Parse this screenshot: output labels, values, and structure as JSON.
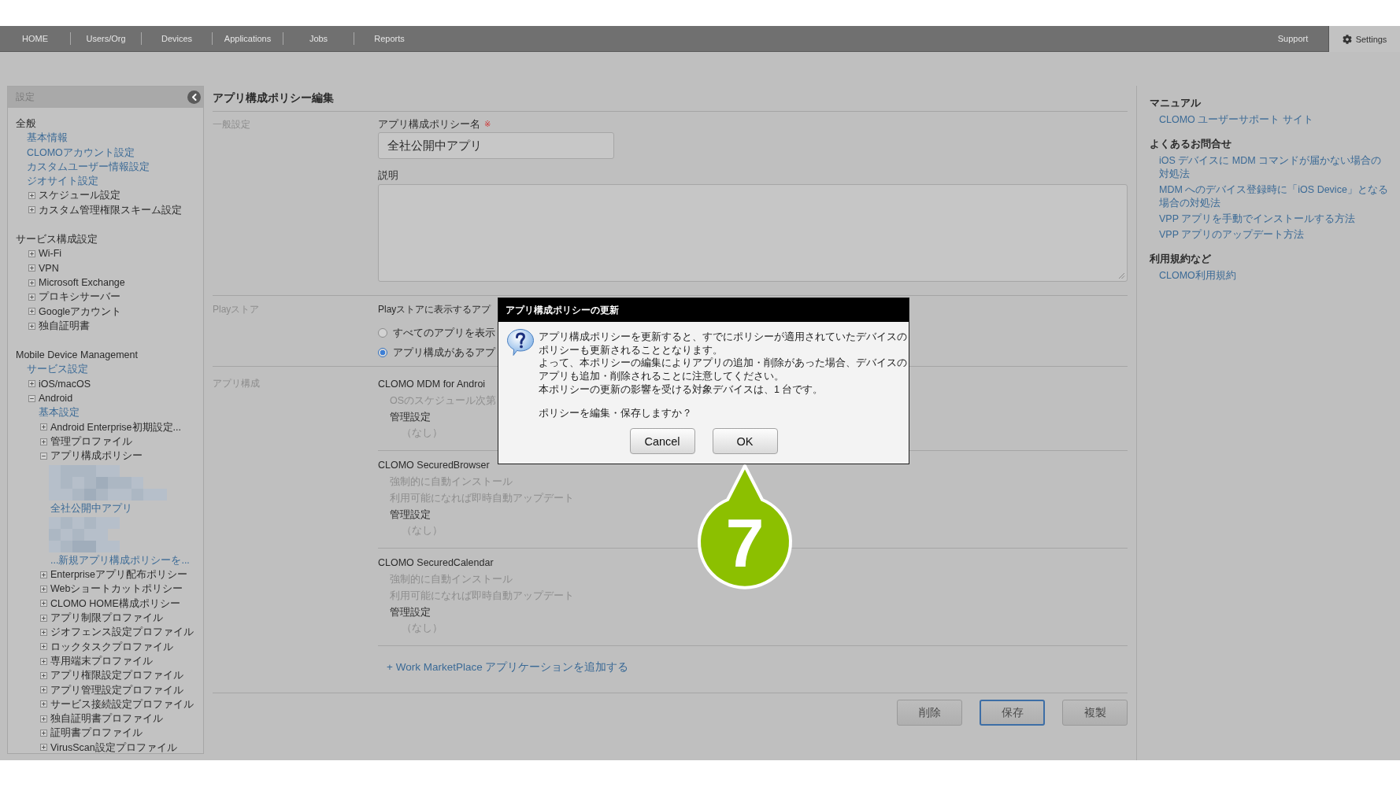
{
  "nav": {
    "items": [
      {
        "label": "HOME",
        "selected": false
      },
      {
        "label": "Users/Org",
        "selected": false
      },
      {
        "label": "Devices",
        "selected": false
      },
      {
        "label": "Applications",
        "selected": false
      },
      {
        "label": "Jobs",
        "selected": false
      },
      {
        "label": "Reports",
        "selected": false
      }
    ],
    "support": {
      "label": "Support"
    },
    "settings_tab": {
      "label": "Settings",
      "selected": true
    }
  },
  "sidebar": {
    "title": "設定",
    "sections": [
      {
        "title": "全般",
        "items": [
          {
            "kind": "link",
            "label": "基本情報"
          },
          {
            "kind": "link",
            "label": "CLOMOアカウント設定"
          },
          {
            "kind": "link",
            "label": "カスタムユーザー情報設定"
          },
          {
            "kind": "link",
            "label": "ジオサイト設定"
          },
          {
            "kind": "folder",
            "label": "スケジュール設定",
            "expanded": false
          },
          {
            "kind": "folder",
            "label": "カスタム管理権限スキーム設定",
            "expanded": false
          }
        ]
      },
      {
        "title": "サービス構成設定",
        "items": [
          {
            "kind": "folder",
            "label": "Wi-Fi",
            "expanded": false
          },
          {
            "kind": "folder",
            "label": "VPN",
            "expanded": false
          },
          {
            "kind": "folder",
            "label": "Microsoft Exchange",
            "expanded": false
          },
          {
            "kind": "folder",
            "label": "プロキシサーバー",
            "expanded": false
          },
          {
            "kind": "folder",
            "label": "Googleアカウント",
            "expanded": false
          },
          {
            "kind": "folder",
            "label": "独自証明書",
            "expanded": false
          }
        ]
      },
      {
        "title": "Mobile Device Management",
        "items": [
          {
            "kind": "link",
            "label": "サービス設定"
          },
          {
            "kind": "folder",
            "label": "iOS/macOS",
            "expanded": false
          },
          {
            "kind": "folder",
            "label": "Android",
            "expanded": true,
            "children": [
              {
                "kind": "link",
                "label": "基本設定"
              },
              {
                "kind": "folder",
                "label": "Android Enterprise初期設定...",
                "expanded": false
              },
              {
                "kind": "folder",
                "label": "管理プロファイル",
                "expanded": false
              },
              {
                "kind": "folder",
                "label": "アプリ構成ポリシー",
                "expanded": true,
                "children": [
                  {
                    "kind": "redacted"
                  },
                  {
                    "kind": "link",
                    "label": "全社公開中アプリ"
                  },
                  {
                    "kind": "redacted"
                  },
                  {
                    "kind": "link",
                    "label": "...新規アプリ構成ポリシーを..."
                  }
                ]
              },
              {
                "kind": "folder",
                "label": "Enterpriseアプリ配布ポリシー",
                "expanded": false
              },
              {
                "kind": "folder",
                "label": "Webショートカットポリシー",
                "expanded": false
              },
              {
                "kind": "folder",
                "label": "CLOMO HOME構成ポリシー",
                "expanded": false
              },
              {
                "kind": "folder",
                "label": "アプリ制限プロファイル",
                "expanded": false
              },
              {
                "kind": "folder",
                "label": "ジオフェンス設定プロファイル",
                "expanded": false
              },
              {
                "kind": "folder",
                "label": "ロックタスクプロファイル",
                "expanded": false
              },
              {
                "kind": "folder",
                "label": "専用端末プロファイル",
                "expanded": false
              },
              {
                "kind": "folder",
                "label": "アプリ権限設定プロファイル",
                "expanded": false
              },
              {
                "kind": "folder",
                "label": "アプリ管理設定プロファイル",
                "expanded": false
              },
              {
                "kind": "folder",
                "label": "サービス接続設定プロファイル",
                "expanded": false
              },
              {
                "kind": "folder",
                "label": "独自証明書プロファイル",
                "expanded": false
              },
              {
                "kind": "folder",
                "label": "証明書プロファイル",
                "expanded": false
              },
              {
                "kind": "folder",
                "label": "VirusScan設定プロファイル",
                "expanded": false
              }
            ]
          }
        ]
      }
    ]
  },
  "main": {
    "title": "アプリ構成ポリシー編集",
    "general": {
      "label": "一般設定",
      "name_label": "アプリ構成ポリシー名",
      "required_mark": "※",
      "name_value": "全社公開中アプリ",
      "description_label": "説明"
    },
    "play_store": {
      "label": "Playストア",
      "prompt": "Playストアに表示するアプ",
      "options": [
        {
          "label": "すべてのアプリを表示",
          "selected": false
        },
        {
          "label": "アプリ構成があるアプ",
          "selected": true
        }
      ]
    },
    "app_config": {
      "label": "アプリ構成",
      "apps": [
        {
          "name": "CLOMO MDM for Androi",
          "notes": [
            "OSのスケジュール次第"
          ],
          "settings_label": "管理設定",
          "settings_value": "（なし）"
        },
        {
          "name": "CLOMO SecuredBrowser",
          "notes": [
            "強制的に自動インストール",
            "利用可能になれば即時自動アップデート"
          ],
          "settings_label": "管理設定",
          "settings_value": "（なし）"
        },
        {
          "name": "CLOMO SecuredCalendar",
          "notes": [
            "強制的に自動インストール",
            "利用可能になれば即時自動アップデート"
          ],
          "settings_label": "管理設定",
          "settings_value": "（なし）"
        }
      ],
      "add_link": "+ Work MarketPlace アプリケーションを追加する"
    },
    "actions": [
      {
        "label": "削除",
        "kind": "default"
      },
      {
        "label": "保存",
        "kind": "primary"
      },
      {
        "label": "複製",
        "kind": "default"
      }
    ]
  },
  "help": {
    "sections": [
      {
        "title": "マニュアル",
        "links": [
          "CLOMO ユーザーサポート サイト"
        ]
      },
      {
        "title": "よくあるお問合せ",
        "links": [
          "iOS デバイスに MDM コマンドが届かない場合の対処法",
          "MDM へのデバイス登録時に「iOS Device」となる場合の対処法",
          "VPP アプリを手動でインストールする方法",
          "VPP アプリのアップデート方法"
        ]
      },
      {
        "title": "利用規約など",
        "links": [
          "CLOMO利用規約"
        ]
      }
    ]
  },
  "dialog": {
    "title": "アプリ構成ポリシーの更新",
    "paragraphs": [
      "アプリ構成ポリシーを更新すると、すでにポリシーが適用されていたデバイスのポリシーも更新されることとなります。",
      "よって、本ポリシーの編集によりアプリの追加・削除があった場合、デバイスのアプリも追加・削除されることに注意してください。",
      "本ポリシーの更新の影響を受ける対象デバイスは、1 台です。"
    ],
    "question": "ポリシーを編集・保存しますか？",
    "buttons": [
      "Cancel",
      "OK"
    ]
  },
  "callout": {
    "number": "7"
  }
}
